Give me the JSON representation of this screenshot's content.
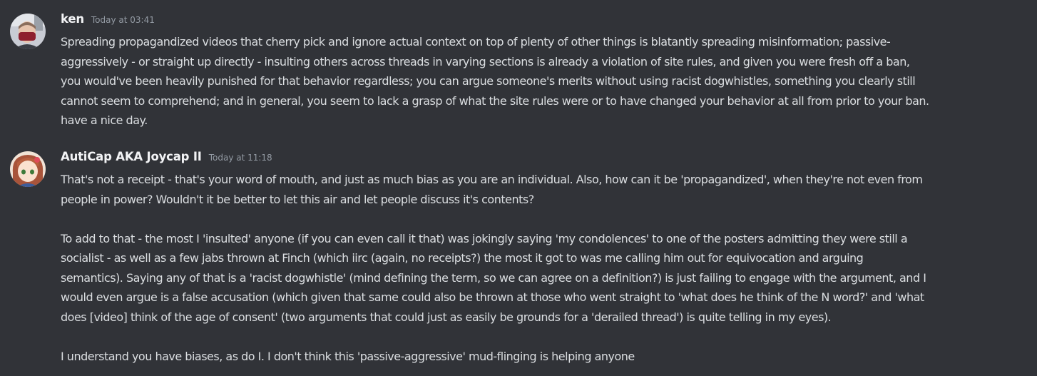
{
  "colors": {
    "background": "#313338",
    "username": "#f2f3f5",
    "timestamp": "#949ba4",
    "text": "#dbdee1"
  },
  "messages": [
    {
      "avatar_icon": "user-avatar-masked-man",
      "username": "ken",
      "timestamp": "Today at 03:41",
      "lines": [
        "Spreading propagandized videos that cherry pick and ignore actual context on top of plenty of other things is blatantly spreading misinformation; passive-",
        "aggressively - or straight up directly - insulting others across threads in varying sections is already a violation of site rules, and given you were fresh off a ban,",
        "you would've been heavily punished for that behavior regardless; you can argue someone's merits without using racist dogwhistles, something you clearly still",
        "cannot seem to comprehend; and in general, you seem to lack a grasp of what the site rules were or to have changed your behavior at all from prior to your ban.",
        "have a nice day."
      ]
    },
    {
      "avatar_icon": "user-avatar-anime-girl",
      "username": "AutiCap AKA Joycap II",
      "timestamp": "Today at 11:18",
      "lines": [
        "That's not a receipt - that's your word of mouth, and just as much bias as you are an individual. Also, how can it be 'propagandized', when they're not even from",
        "people in power? Wouldn't it be better to let this air and let people discuss it's contents?",
        "",
        "To add to that - the most I 'insulted' anyone (if you can even call it that) was jokingly saying 'my condolences' to one of the posters admitting they were still a",
        "socialist - as well as a few jabs thrown at Finch (which iirc (again, no receipts?) the most it got to was me calling him out for equivocation and arguing",
        "semantics). Saying any of that is a 'racist dogwhistle' (mind defining the term, so we can agree on a definition?) is just failing to engage with the argument, and I",
        "would even argue is a false accusation (which given that same could also be thrown at those who went straight to 'what does he think of the N word?' and 'what",
        "does [video] think of the age of consent' (two arguments that could just as easily be grounds for a 'derailed thread') is quite telling in my eyes).",
        "",
        "I understand you have biases, as do I. I don't think this 'passive-aggressive' mud-flinging is helping anyone"
      ]
    }
  ]
}
